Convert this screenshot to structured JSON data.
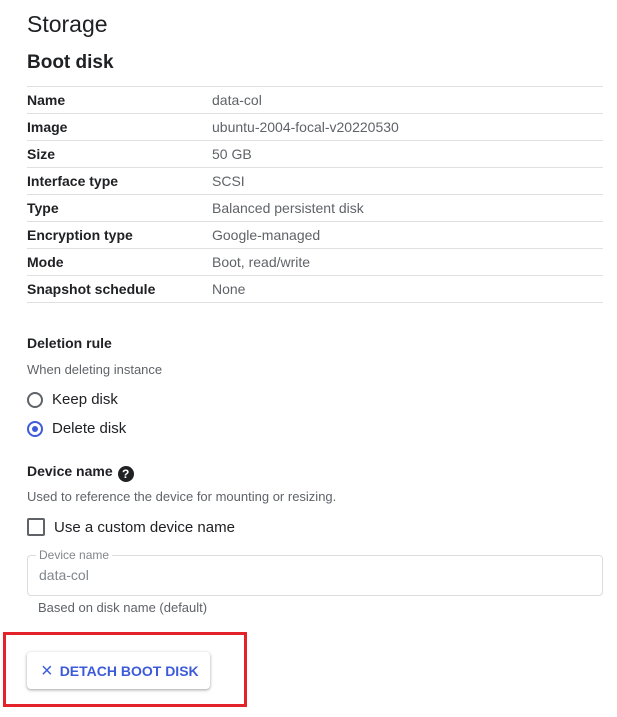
{
  "page_title": "Storage",
  "boot_disk": {
    "title": "Boot disk",
    "rows": [
      {
        "key": "Name",
        "value": "data-col"
      },
      {
        "key": "Image",
        "value": "ubuntu-2004-focal-v20220530"
      },
      {
        "key": "Size",
        "value": "50 GB"
      },
      {
        "key": "Interface type",
        "value": "SCSI"
      },
      {
        "key": "Type",
        "value": "Balanced persistent disk"
      },
      {
        "key": "Encryption type",
        "value": "Google-managed"
      },
      {
        "key": "Mode",
        "value": "Boot, read/write"
      },
      {
        "key": "Snapshot schedule",
        "value": "None"
      }
    ]
  },
  "deletion_rule": {
    "title": "Deletion rule",
    "description": "When deleting instance",
    "options": [
      {
        "label": "Keep disk",
        "checked": false
      },
      {
        "label": "Delete disk",
        "checked": true
      }
    ]
  },
  "device_name": {
    "title": "Device name",
    "help_icon": "?",
    "description": "Used to reference the device for mounting or resizing.",
    "checkbox_label": "Use a custom device name",
    "checkbox_checked": false,
    "field_label": "Device name",
    "field_value": "data-col",
    "field_hint": "Based on disk name (default)"
  },
  "detach_button": {
    "icon": "×",
    "label": "DETACH BOOT DISK"
  },
  "colors": {
    "accent": "#3d5bd9",
    "highlight": "#e3222a"
  }
}
